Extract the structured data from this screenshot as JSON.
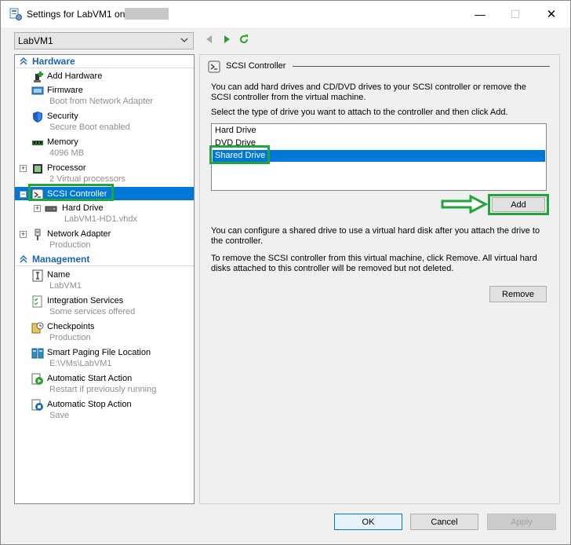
{
  "window": {
    "title": "Settings for LabVM1 on",
    "minimize_glyph": "—",
    "maximize_glyph": "☐",
    "close_glyph": "✕"
  },
  "vm_selector": {
    "value": "LabVM1"
  },
  "nav": {
    "back_icon": "back-arrow-icon",
    "forward_icon": "forward-arrow-icon",
    "refresh_icon": "refresh-icon"
  },
  "tree": {
    "hardware_label": "Hardware",
    "management_label": "Management",
    "hardware_items": [
      {
        "label": "Add Hardware",
        "sub": "",
        "icon": "add-hardware-icon"
      },
      {
        "label": "Firmware",
        "sub": "Boot from Network Adapter",
        "icon": "firmware-icon"
      },
      {
        "label": "Security",
        "sub": "Secure Boot enabled",
        "icon": "shield-icon"
      },
      {
        "label": "Memory",
        "sub": "4096 MB",
        "icon": "memory-icon"
      },
      {
        "label": "Processor",
        "sub": "2 Virtual processors",
        "icon": "processor-icon",
        "expander": "+"
      },
      {
        "label": "SCSI Controller",
        "sub": "",
        "icon": "scsi-controller-icon",
        "expander": "−",
        "selected": true
      },
      {
        "label": "Hard Drive",
        "sub": "LabVM1-HD1.vhdx",
        "icon": "hard-drive-icon",
        "expander": "+"
      },
      {
        "label": "Network Adapter",
        "sub": "Production",
        "icon": "network-adapter-icon",
        "expander": "+"
      }
    ],
    "management_items": [
      {
        "label": "Name",
        "sub": "LabVM1",
        "icon": "name-icon"
      },
      {
        "label": "Integration Services",
        "sub": "Some services offered",
        "icon": "integration-services-icon"
      },
      {
        "label": "Checkpoints",
        "sub": "Production",
        "icon": "checkpoints-icon"
      },
      {
        "label": "Smart Paging File Location",
        "sub": "E:\\VMs\\LabVM1",
        "icon": "smart-paging-icon"
      },
      {
        "label": "Automatic Start Action",
        "sub": "Restart if previously running",
        "icon": "automatic-start-icon"
      },
      {
        "label": "Automatic Stop Action",
        "sub": "Save",
        "icon": "automatic-stop-icon"
      }
    ]
  },
  "pane": {
    "heading": "SCSI Controller",
    "intro": "You can add hard drives and CD/DVD drives to your SCSI controller or remove the SCSI controller from the virtual machine.",
    "select_prompt": "Select the type of drive you want to attach to the controller and then click Add.",
    "drive_types": [
      "Hard Drive",
      "DVD Drive",
      "Shared Drive"
    ],
    "selected_drive_type": "Shared Drive",
    "add_button": "Add",
    "shared_note": "You can configure a shared drive to use a virtual hard disk after you attach the drive to the controller.",
    "remove_note": "To remove the SCSI controller from this virtual machine, click Remove. All virtual hard disks attached to this controller will be removed but not deleted.",
    "remove_button": "Remove"
  },
  "footer": {
    "ok": "OK",
    "cancel": "Cancel",
    "apply": "Apply"
  },
  "colors": {
    "selection": "#0078d7",
    "highlight_box": "#22a53a",
    "section_text": "#1c63b7"
  }
}
